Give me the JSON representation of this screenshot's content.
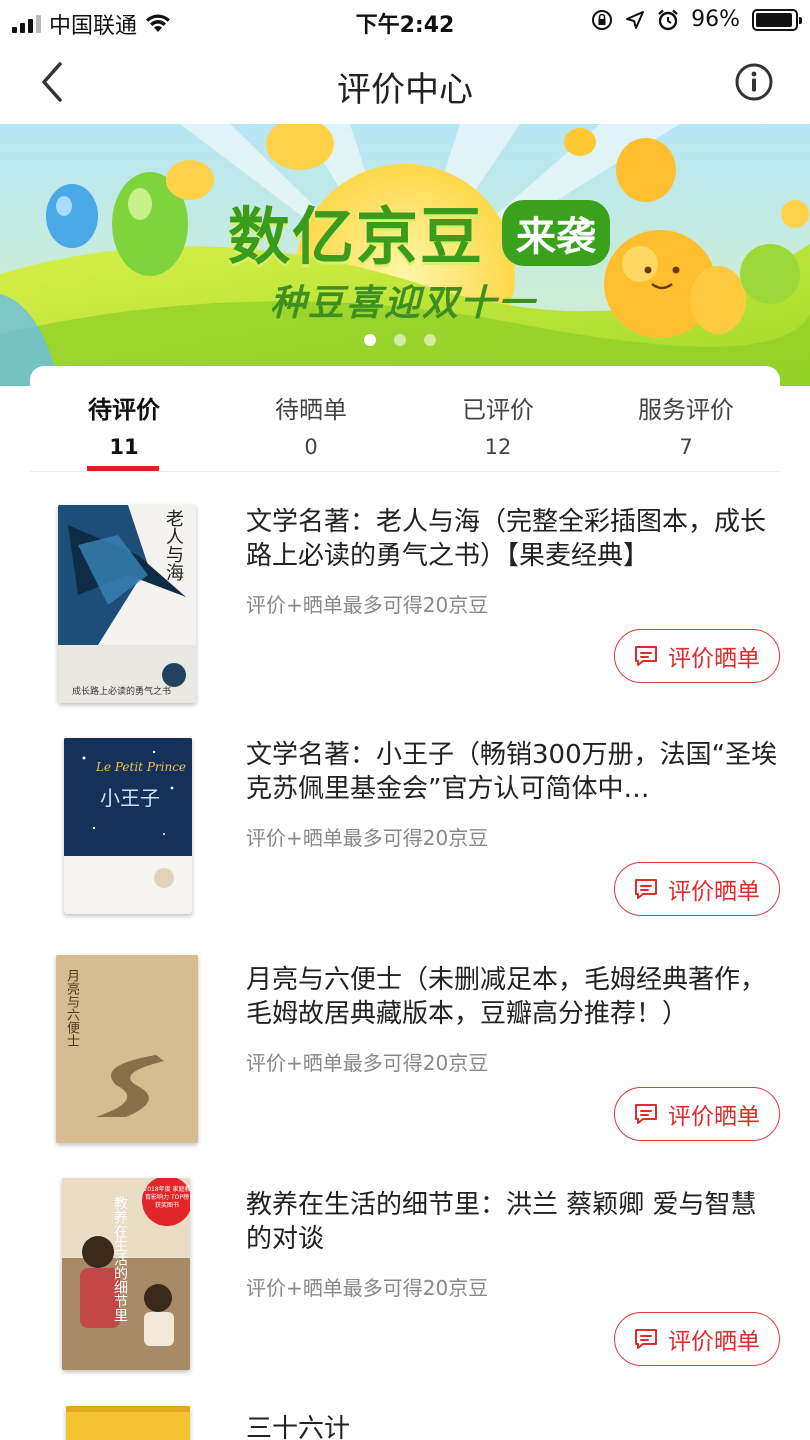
{
  "status_bar": {
    "carrier": "中国联通",
    "time": "下午2:42",
    "battery": "96%",
    "battery_level": 0.96
  },
  "nav": {
    "title": "评价中心",
    "back_icon": "chevron-left-icon",
    "info_icon": "info-icon"
  },
  "banner": {
    "title": "数亿京豆",
    "tag": "来袭",
    "subtitle": "种豆喜迎双十一",
    "slide_count": 3,
    "active_slide": 0,
    "colors": {
      "sky": "#a9e0f3",
      "grass": "#b9e23b",
      "title": "#3a9b1c"
    }
  },
  "tabs": [
    {
      "label": "待评价",
      "count": "11",
      "active": true
    },
    {
      "label": "待晒单",
      "count": "0",
      "active": false
    },
    {
      "label": "已评价",
      "count": "12",
      "active": false
    },
    {
      "label": "服务评价",
      "count": "7",
      "active": false
    }
  ],
  "items": [
    {
      "title": "文学名著：老人与海（完整全彩插图本，成长路上必读的勇气之书）【果麦经典】",
      "note": "评价+晒单最多可得20京豆",
      "button": "评价晒单",
      "cover_text": "老人与海",
      "cover_tagline": "成长路上必读的勇气之书"
    },
    {
      "title": "文学名著：小王子（畅销300万册，法国“圣埃克苏佩里基金会”官方认可简体中…",
      "note": "评价+晒单最多可得20京豆",
      "button": "评价晒单",
      "cover_text": "小王子",
      "cover_script": "Le Petit Prince"
    },
    {
      "title": "月亮与六便士（未删减足本，毛姆经典著作，毛姆故居典藏版本，豆瓣高分推荐！）",
      "note": "评价+晒单最多可得20京豆",
      "button": "评价晒单",
      "cover_text": "月亮与六便士"
    },
    {
      "title": "教养在生活的细节里：洪兰 蔡颖卿 爱与智慧的对谈",
      "note": "评价+晒单最多可得20京豆",
      "button": "评价晒单",
      "cover_text": "教养在生活的细节里",
      "cover_badge": "2018年度 家庭教育影响力 TOP榜 获奖图书"
    },
    {
      "title": "三十六计",
      "note": "",
      "button": ""
    }
  ],
  "colors": {
    "accent": "#e02020",
    "button_border": "#e23a3a",
    "muted_text": "#888888"
  }
}
